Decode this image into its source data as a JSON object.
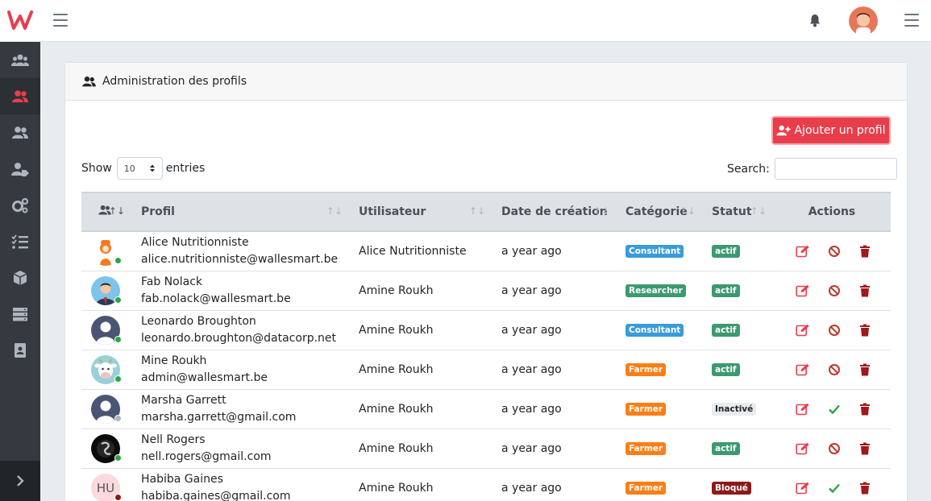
{
  "page": {
    "title": "Administration des profils",
    "add_button": "Ajouter un profil"
  },
  "controls": {
    "show_label": "Show",
    "entries_value": "10",
    "entries_label": "entries",
    "search_label": "Search:"
  },
  "table": {
    "headers": {
      "profil": "Profil",
      "utilisateur": "Utilisateur",
      "date": "Date de création",
      "categorie": "Catégorie",
      "statut": "Statut",
      "actions": "Actions"
    },
    "rows": [
      {
        "name": "Alice Nutritionniste",
        "email": "alice.nutritionniste@wallesmart.be",
        "user": "Alice Nutritionniste",
        "date": "a year ago",
        "category": "Consultant",
        "status": "actif",
        "avatar": "orange-person",
        "presence": "online"
      },
      {
        "name": "Fab Nolack",
        "email": "fab.nolack@wallesmart.be",
        "user": "Amine Roukh",
        "date": "a year ago",
        "category": "Researcher",
        "status": "actif",
        "avatar": "suit-man",
        "presence": "online"
      },
      {
        "name": "Leonardo Broughton",
        "email": "leonardo.broughton@datacorp.net",
        "user": "Amine Roukh",
        "date": "a year ago",
        "category": "Consultant",
        "status": "actif",
        "avatar": "default-user",
        "presence": "online"
      },
      {
        "name": "Mine Roukh",
        "email": "admin@wallesmart.be",
        "user": "Amine Roukh",
        "date": "a year ago",
        "category": "Farmer",
        "status": "actif",
        "avatar": "cow",
        "presence": "online"
      },
      {
        "name": "Marsha Garrett",
        "email": "marsha.garrett@gmail.com",
        "user": "Amine Roukh",
        "date": "a year ago",
        "category": "Farmer",
        "status": "Inactivé",
        "avatar": "default-user",
        "presence": "offline"
      },
      {
        "name": "Nell Rogers",
        "email": "nell.rogers@gmail.com",
        "user": "Amine Roukh",
        "date": "a year ago",
        "category": "Farmer",
        "status": "actif",
        "avatar": "dark-portrait",
        "presence": "online"
      },
      {
        "name": "Habiba Gaines",
        "email": "habiba.gaines@gmail.com",
        "user": "Amine Roukh",
        "date": "a year ago",
        "category": "Farmer",
        "status": "Bloqué",
        "avatar": "HU",
        "presence": "blocked"
      }
    ]
  },
  "colors": {
    "brand": "#e83e4c",
    "sidebar": "#343a40",
    "consultant": "#3a9bd9",
    "researcher": "#3d9970",
    "farmer": "#fd7e14",
    "actif": "#3d9970",
    "inactive": "#e9ecef",
    "blocked": "#8b1a1a",
    "online": "#28a745",
    "offline": "#adb5bd"
  },
  "sidebar_icons": [
    "users-icon",
    "user-group-icon",
    "user-group-icon",
    "user-tag-icon",
    "cogs-icon",
    "tasks-icon",
    "cube-icon",
    "server-icon",
    "address-book-icon"
  ]
}
